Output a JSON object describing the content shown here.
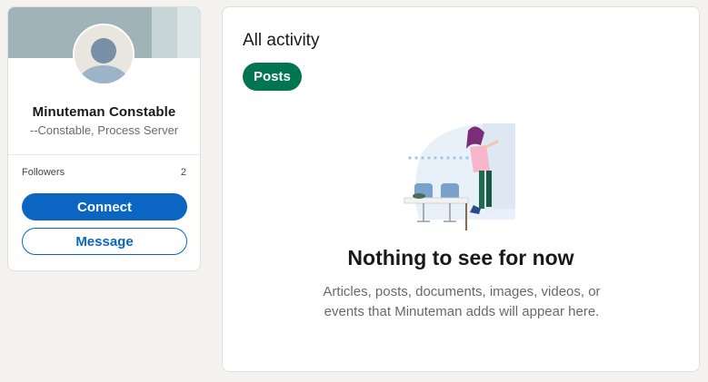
{
  "profile": {
    "name": "Minuteman Constable",
    "headline": "--Constable, Process Server",
    "followers_label": "Followers",
    "followers_count": "2",
    "connect_label": "Connect",
    "message_label": "Message",
    "avatar_icon": "default-person-avatar-icon"
  },
  "activity": {
    "title": "All activity",
    "filter_pill": "Posts",
    "empty_title": "Nothing to see for now",
    "empty_description": "Articles, posts, documents, images, videos, or events that Minuteman adds will appear here.",
    "illustration_icon": "empty-office-illustration"
  },
  "colors": {
    "primary_blue": "#0a66c2",
    "pill_green": "#01754f",
    "page_background": "#f3f2ef"
  }
}
